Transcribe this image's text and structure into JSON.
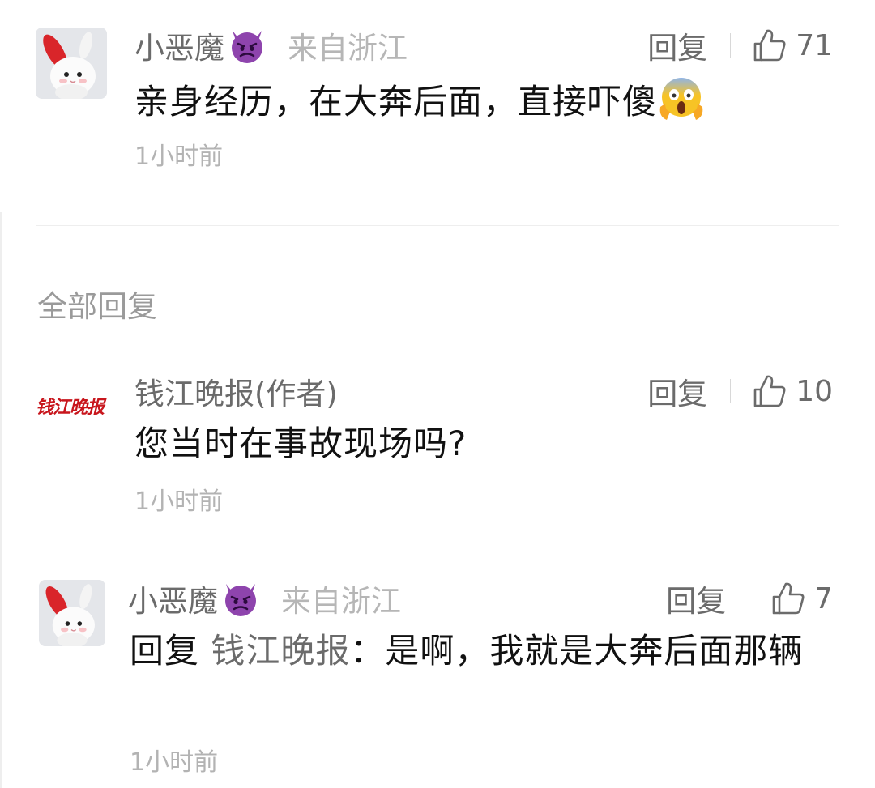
{
  "top_comment": {
    "username": "小恶魔",
    "username_emoji": "smiling-face-with-horns",
    "location": "来自浙江",
    "reply_label": "回复",
    "like_count": "71",
    "text": "亲身经历，在大奔后面，直接吓傻",
    "text_emoji": "face-screaming-in-fear",
    "time": "1小时前"
  },
  "replies_section": {
    "title": "全部回复"
  },
  "replies": [
    {
      "username": "钱江晚报(作者)",
      "avatar_brand_text": "钱江晚报",
      "reply_label": "回复",
      "like_count": "10",
      "text": "您当时在事故现场吗?",
      "time": "1小时前"
    },
    {
      "username": "小恶魔",
      "username_emoji": "smiling-face-with-horns",
      "location": "来自浙江",
      "reply_label": "回复",
      "like_count": "7",
      "reply_prefix": "回复",
      "reply_target": "钱江晚报",
      "reply_colon": "：",
      "text": "是啊，我就是大奔后面那辆",
      "time": "1小时前"
    }
  ],
  "colors": {
    "secondary_text": "#6b6b6b",
    "muted_text": "#b3b3b3",
    "brand_red": "#c8161d",
    "devil_purple": "#8e44ad",
    "scream_yellow": "#f7c325"
  },
  "icons": [
    "rabbit-avatar",
    "thumbs-up-icon",
    "devil-emoji-icon",
    "scream-emoji-icon"
  ]
}
